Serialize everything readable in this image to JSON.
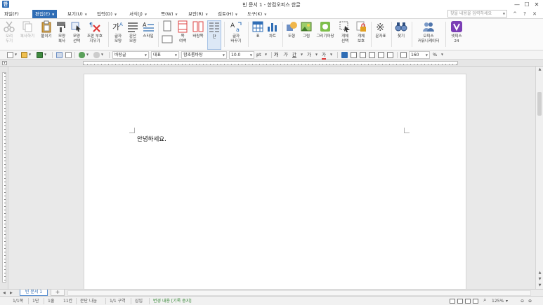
{
  "app": {
    "title": "빈 문서 1 - 한컴오피스 한글",
    "icon_glyph": "한"
  },
  "window": {
    "min": "—",
    "max": "☐",
    "close": "✕"
  },
  "menu": {
    "items": [
      {
        "label": "파일(F)",
        "active": false
      },
      {
        "label": "편집(E)",
        "active": true
      },
      {
        "label": "보기(U)",
        "active": false
      },
      {
        "label": "입력(D)",
        "active": false
      },
      {
        "label": "서식(J)",
        "active": false
      },
      {
        "label": "쪽(W)",
        "active": false
      },
      {
        "label": "보안(R)",
        "active": false
      },
      {
        "label": "검토(H)",
        "active": false
      },
      {
        "label": "도구(K)",
        "active": false
      }
    ],
    "search_placeholder": "찾을 내용을 입력하세요",
    "ribbon_collapse": "^",
    "help": "?",
    "ribbon_close": "✕"
  },
  "ribbon": {
    "buttons": [
      {
        "label1": "오려",
        "label2": "두기",
        "disabled": true
      },
      {
        "label1": "복사하기",
        "label2": "",
        "disabled": true
      },
      {
        "label1": "붙이기",
        "label2": "",
        "disabled": false
      },
      {
        "label1": "모양",
        "label2": "복사",
        "disabled": false
      },
      {
        "label1": "모양",
        "label2": "선택",
        "disabled": false
      },
      {
        "label1": "조판 부호",
        "label2": "지우기",
        "disabled": false
      },
      {
        "label1": "글자",
        "label2": "모양",
        "disabled": false
      },
      {
        "label1": "문단",
        "label2": "모양",
        "disabled": false
      },
      {
        "label1": "스타일",
        "label2": "",
        "disabled": false
      },
      {
        "label1": "",
        "label2": "",
        "disabled": false
      },
      {
        "label1": "쪽",
        "label2": "여백",
        "disabled": false
      },
      {
        "label1": "바탕쪽",
        "label2": "",
        "disabled": false
      },
      {
        "label1": "단",
        "label2": "",
        "disabled": false
      },
      {
        "label1": "글자",
        "label2": "바꾸기",
        "disabled": false
      },
      {
        "label1": "표",
        "label2": "",
        "disabled": false
      },
      {
        "label1": "차트",
        "label2": "",
        "disabled": false
      },
      {
        "label1": "도형",
        "label2": "",
        "disabled": false
      },
      {
        "label1": "그림",
        "label2": "",
        "disabled": false
      },
      {
        "label1": "그리기마당",
        "label2": "",
        "disabled": false
      },
      {
        "label1": "개체",
        "label2": "선택",
        "disabled": false
      },
      {
        "label1": "개체",
        "label2": "보호",
        "disabled": false
      },
      {
        "label1": "문자표",
        "label2": "",
        "disabled": false
      },
      {
        "label1": "찾기",
        "label2": "",
        "disabled": false
      },
      {
        "label1": "오피스",
        "label2": "커뮤니케이터",
        "disabled": false
      },
      {
        "label1": "넷피스",
        "label2": "24",
        "disabled": false
      }
    ]
  },
  "toolbar": {
    "style": "바탕글",
    "lang": "대표",
    "font": "함초롬바탕",
    "size": "10.0",
    "size_unit": "pt",
    "bold": "가",
    "italic": "가",
    "underline": "간",
    "charcolor": "가",
    "highlight": "가",
    "zoom": "160",
    "zoom_unit": "%"
  },
  "document": {
    "text": "안녕하세요."
  },
  "tabs": {
    "doc_tab": "빈 문서 1",
    "add_tab": "+"
  },
  "status": {
    "page": "1/1쪽",
    "section": "1단",
    "line": "1줄",
    "col": "11칸",
    "para": "문단 나눔",
    "zone": "1/1 구역",
    "insert": "삽입",
    "track": "변경 내용 [기록 중지]",
    "zoom": "125%"
  },
  "colors": {
    "accent": "#2f6db5",
    "status_green": "#3a8a3a"
  }
}
